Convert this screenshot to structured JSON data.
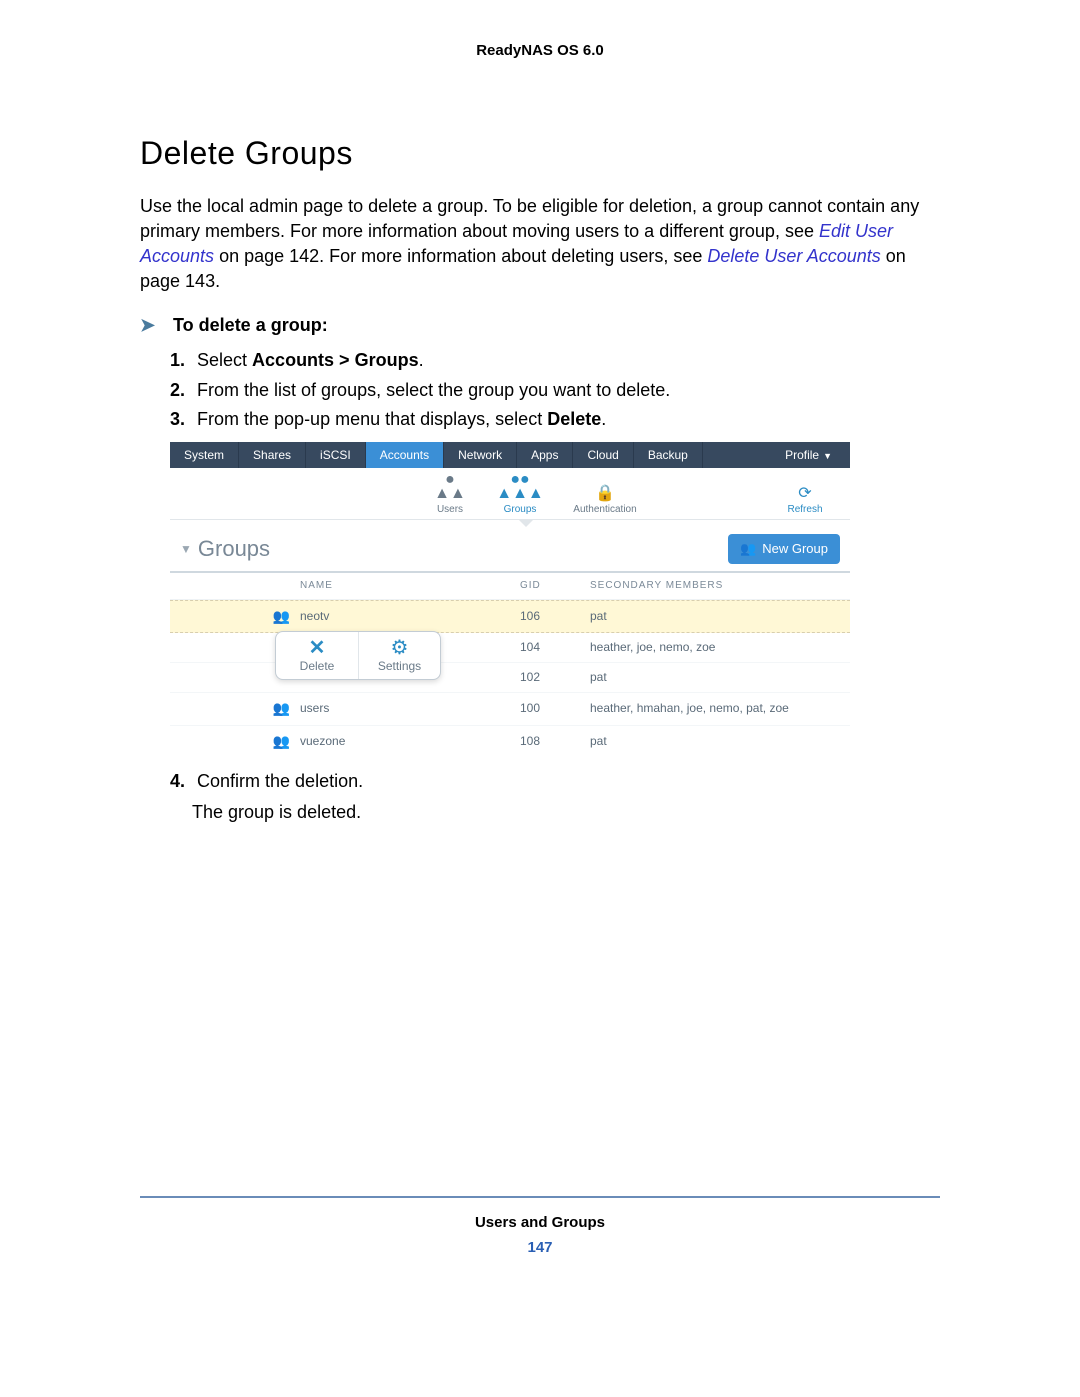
{
  "doc_header": "ReadyNAS OS 6.0",
  "section_title": "Delete Groups",
  "intro": {
    "pre": "Use the local admin page to delete a group. To be eligible for deletion, a group cannot contain any primary members. For more information about moving users to a different group, see ",
    "link1": "Edit User Accounts",
    "mid1": " on page 142. For more information about deleting users, see ",
    "link2": "Delete User Accounts",
    "post": " on page 143."
  },
  "subhead": "To delete a group:",
  "steps": {
    "s1a": "Select ",
    "s1b": "Accounts > Groups",
    "s1c": ".",
    "s2": "From the list of groups, select the group you want to delete.",
    "s3a": "From the pop-up menu that displays, select ",
    "s3b": "Delete",
    "s3c": ".",
    "s4": "Confirm the deletion.",
    "s4_result": "The group is deleted."
  },
  "nav": {
    "system": "System",
    "shares": "Shares",
    "iscsi": "iSCSI",
    "accounts": "Accounts",
    "network": "Network",
    "apps": "Apps",
    "cloud": "Cloud",
    "backup": "Backup",
    "profile": "Profile"
  },
  "toolbar": {
    "users": "Users",
    "groups": "Groups",
    "auth": "Authentication",
    "refresh": "Refresh"
  },
  "groups_title": "Groups",
  "new_group_btn": "New Group",
  "columns": {
    "name": "NAME",
    "gid": "GID",
    "members": "SECONDARY MEMBERS"
  },
  "rows": [
    {
      "name": "neotv",
      "gid": "106",
      "members": "pat",
      "icon": "orange"
    },
    {
      "name": "",
      "gid": "104",
      "members": "heather, joe, nemo, zoe",
      "icon": ""
    },
    {
      "name": "",
      "gid": "102",
      "members": "pat",
      "icon": ""
    },
    {
      "name": "users",
      "gid": "100",
      "members": "heather, hmahan, joe, nemo, pat, zoe",
      "icon": "blue"
    },
    {
      "name": "vuezone",
      "gid": "108",
      "members": "pat",
      "icon": "orange"
    }
  ],
  "popup": {
    "delete": "Delete",
    "settings": "Settings"
  },
  "footer": {
    "title": "Users and Groups",
    "page": "147"
  }
}
